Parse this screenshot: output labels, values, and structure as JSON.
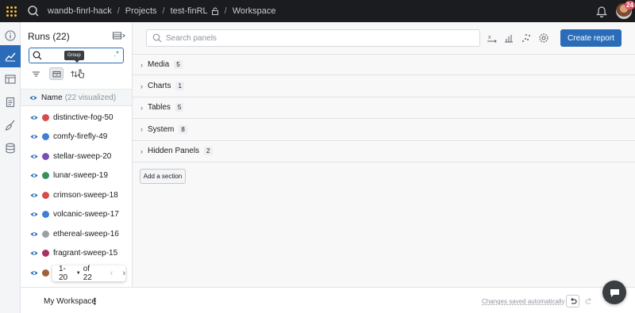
{
  "topbar": {
    "breadcrumbs": [
      {
        "label": "wandb-finrl-hack"
      },
      {
        "label": "Projects"
      },
      {
        "label": "test-finRL"
      },
      {
        "label": "Workspace"
      }
    ],
    "notification_count": "24",
    "icons": {
      "logo": "wandb-logo-icon",
      "search": "search-icon",
      "lock": "lock-icon",
      "bell": "bell-icon"
    }
  },
  "rail": {
    "items": [
      {
        "icon": "info-icon",
        "active": false
      },
      {
        "icon": "line-chart-icon",
        "active": true
      },
      {
        "icon": "table-icon",
        "active": false
      },
      {
        "icon": "report-icon",
        "active": false
      },
      {
        "icon": "sweep-broom-icon",
        "active": false
      },
      {
        "icon": "artifacts-database-icon",
        "active": false
      }
    ]
  },
  "runs_panel": {
    "title": "Runs",
    "count": "(22)",
    "search_value": "",
    "regex_icon": ".*",
    "tooltip": "Group",
    "name_header": "Name",
    "visualized": "(22 visualized)",
    "runs": [
      {
        "name": "distinctive-fog-50",
        "color": "#d94a4a"
      },
      {
        "name": "comfy-firefly-49",
        "color": "#3f7fd4"
      },
      {
        "name": "stellar-sweep-20",
        "color": "#7b4fb3"
      },
      {
        "name": "lunar-sweep-19",
        "color": "#3a8f5c"
      },
      {
        "name": "crimson-sweep-18",
        "color": "#d94a4a"
      },
      {
        "name": "volcanic-sweep-17",
        "color": "#3f7fd4"
      },
      {
        "name": "ethereal-sweep-16",
        "color": "#9aa0a6"
      },
      {
        "name": "fragrant-sweep-15",
        "color": "#a8325e"
      },
      {
        "name": "",
        "color": "#a0603a"
      }
    ],
    "pager": {
      "range": "1-20",
      "of": "of 22"
    }
  },
  "main": {
    "search_placeholder": "Search panels",
    "create_report": "Create report",
    "sections": [
      {
        "label": "Media",
        "count": "5"
      },
      {
        "label": "Charts",
        "count": "1"
      },
      {
        "label": "Tables",
        "count": "5"
      },
      {
        "label": "System",
        "count": "8"
      },
      {
        "label": "Hidden Panels",
        "count": "2"
      }
    ],
    "add_section": "Add a section"
  },
  "bottombar": {
    "workspace_name": "My Workspace",
    "menu_glyph": "⋮",
    "saved_status": "Changes saved automatically"
  }
}
